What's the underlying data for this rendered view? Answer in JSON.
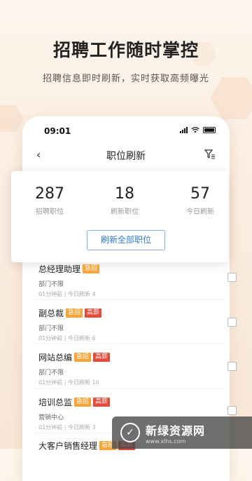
{
  "hero": {
    "title": "招聘工作随时掌控",
    "subtitle": "招聘信息即时刷新，实时获取高频曝光"
  },
  "statusbar": {
    "time": "09:01"
  },
  "navbar": {
    "back_icon": "chevron-left-icon",
    "title": "职位刷新",
    "filter_icon": "filter-icon"
  },
  "stats": [
    {
      "value": "287",
      "label": "招聘职位"
    },
    {
      "value": "18",
      "label": "刷新职位"
    },
    {
      "value": "57",
      "label": "今日刷新"
    }
  ],
  "refresh_all_label": "刷新全部职位",
  "jobs": [
    {
      "title": "总经理助理",
      "tags": [
        "急招"
      ],
      "dept": "部门不限",
      "meta": "01分钟前 | 今日刷新 4"
    },
    {
      "title": "副总裁",
      "tags": [
        "急招",
        "高薪"
      ],
      "dept": "部门不限",
      "meta": "01分钟前 | 今日刷新 6"
    },
    {
      "title": "网站总编",
      "tags": [
        "急招",
        "高薪"
      ],
      "dept": "部门不限",
      "meta": "01分钟前 | 今日刷新 10"
    },
    {
      "title": "培训总监",
      "tags": [
        "急招",
        "高薪"
      ],
      "dept": "营销中心",
      "meta": "01分钟前 | 今日刷新 3"
    },
    {
      "title": "大客户销售经理",
      "tags": [
        "急招",
        "高薪"
      ],
      "dept": "",
      "meta": ""
    }
  ],
  "watermark": {
    "name": "新绿资源网",
    "url": "www.xlhs.com"
  },
  "colors": {
    "urgent": "#f4a63a",
    "high_pay": "#e84a3a",
    "accent": "#2f7ad8"
  }
}
